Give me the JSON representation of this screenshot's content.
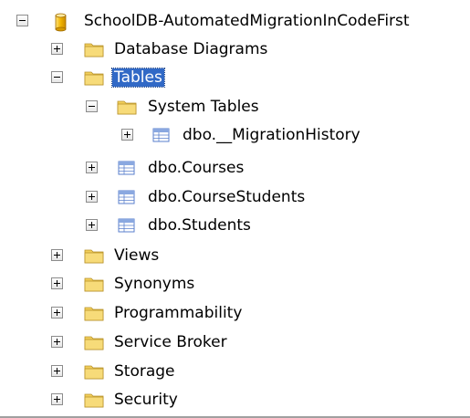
{
  "tree": {
    "root": {
      "label": "SchoolDB-AutomatedMigrationInCodeFirst",
      "icon": "database-icon",
      "expanded": true
    },
    "database_diagrams": {
      "label": "Database Diagrams",
      "icon": "folder-icon",
      "expanded": false
    },
    "tables": {
      "label": "Tables",
      "icon": "folder-icon",
      "expanded": true,
      "selected": true
    },
    "system_tables": {
      "label": "System Tables",
      "icon": "folder-icon",
      "expanded": true
    },
    "migration_history": {
      "label": "dbo.__MigrationHistory",
      "icon": "table-icon",
      "expanded": false
    },
    "courses": {
      "label": "dbo.Courses",
      "icon": "table-icon",
      "expanded": false
    },
    "course_students": {
      "label": "dbo.CourseStudents",
      "icon": "table-icon",
      "expanded": false
    },
    "students": {
      "label": "dbo.Students",
      "icon": "table-icon",
      "expanded": false
    },
    "views": {
      "label": "Views",
      "icon": "folder-icon",
      "expanded": false
    },
    "synonyms": {
      "label": "Synonyms",
      "icon": "folder-icon",
      "expanded": false
    },
    "programmability": {
      "label": "Programmability",
      "icon": "folder-icon",
      "expanded": false
    },
    "service_broker": {
      "label": "Service Broker",
      "icon": "folder-icon",
      "expanded": false
    },
    "storage": {
      "label": "Storage",
      "icon": "folder-icon",
      "expanded": false
    },
    "security": {
      "label": "Security",
      "icon": "folder-icon",
      "expanded": false
    }
  },
  "colors": {
    "selection": "#3169c6",
    "folder": "#f2cf5b",
    "database": "#f0b400",
    "table_icon": "#5a7fcc"
  }
}
